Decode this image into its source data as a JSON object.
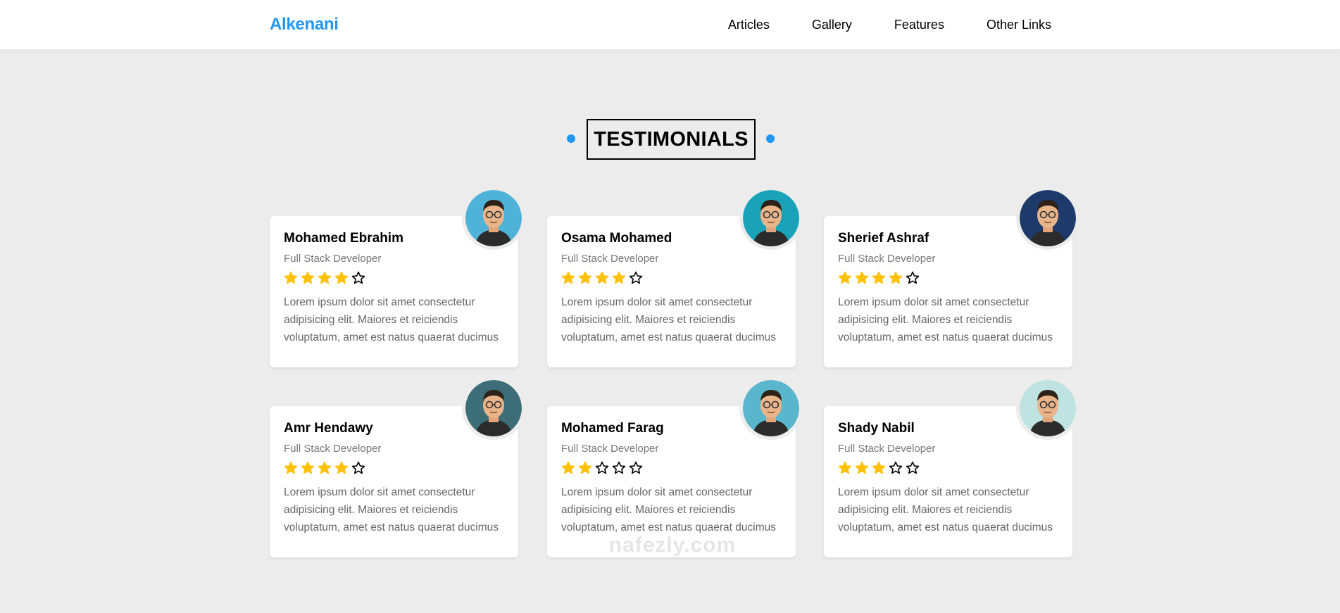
{
  "header": {
    "logo": "Alkenani",
    "nav": [
      "Articles",
      "Gallery",
      "Features",
      "Other Links"
    ]
  },
  "section": {
    "title": "TESTIMONIALS"
  },
  "colors": {
    "accent": "#2196f3",
    "star_filled": "#ffc107",
    "background": "#ececec"
  },
  "testimonials": [
    {
      "name": "Mohamed Ebrahim",
      "role": "Full Stack Developer",
      "rating": 4,
      "text": "Lorem ipsum dolor sit amet consectetur adipisicing elit. Maiores et reiciendis voluptatum, amet est natus quaerat ducimus",
      "avatar_icon": "avatar-bearded-man-glasses-icon",
      "avatar_bg": "#4fb3d9"
    },
    {
      "name": "Osama Mohamed",
      "role": "Full Stack Developer",
      "rating": 4,
      "text": "Lorem ipsum dolor sit amet consectetur adipisicing elit. Maiores et reiciendis voluptatum, amet est natus quaerat ducimus",
      "avatar_icon": "avatar-man-sunglasses-icon",
      "avatar_bg": "#1aa3b8"
    },
    {
      "name": "Sherief Ashraf",
      "role": "Full Stack Developer",
      "rating": 4,
      "text": "Lorem ipsum dolor sit amet consectetur adipisicing elit. Maiores et reiciendis voluptatum, amet est natus quaerat ducimus",
      "avatar_icon": "avatar-man-glasses-icon",
      "avatar_bg": "#1e3a6b"
    },
    {
      "name": "Amr Hendawy",
      "role": "Full Stack Developer",
      "rating": 4,
      "text": "Lorem ipsum dolor sit amet consectetur adipisicing elit. Maiores et reiciendis voluptatum, amet est natus quaerat ducimus",
      "avatar_icon": "avatar-man-pink-glasses-icon",
      "avatar_bg": "#3d6e78"
    },
    {
      "name": "Mohamed Farag",
      "role": "Full Stack Developer",
      "rating": 2,
      "text": "Lorem ipsum dolor sit amet consectetur adipisicing elit. Maiores et reiciendis voluptatum, amet est natus quaerat ducimus",
      "avatar_icon": "avatar-bearded-man-icon",
      "avatar_bg": "#5ab6cc"
    },
    {
      "name": "Shady Nabil",
      "role": "Full Stack Developer",
      "rating": 3,
      "text": "Lorem ipsum dolor sit amet consectetur adipisicing elit. Maiores et reiciendis voluptatum, amet est natus quaerat ducimus",
      "avatar_icon": "avatar-man-dark-glasses-icon",
      "avatar_bg": "#bfe3e0"
    }
  ],
  "watermark": "nafezly.com"
}
